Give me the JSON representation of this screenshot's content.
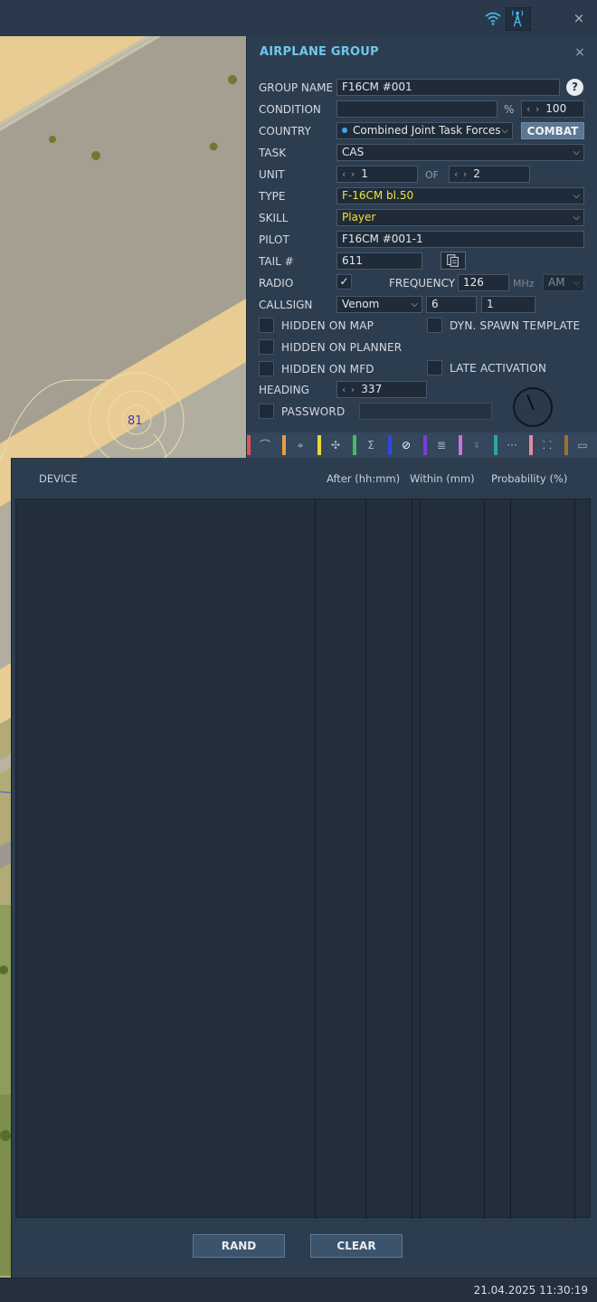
{
  "colors": {
    "accent": "#6fc7ee",
    "combat": "#5d7692",
    "yellow_value": "#f0e23a"
  },
  "topbar": {
    "icons": [
      "wifi-icon",
      "radio-tower-icon",
      "close-icon"
    ],
    "close_glyph": "×"
  },
  "map": {
    "label": "81"
  },
  "panel": {
    "title": "AIRPLANE GROUP",
    "close_glyph": "×",
    "group_name": {
      "label": "GROUP NAME",
      "value": "F16CM #001",
      "help": "?"
    },
    "condition": {
      "label": "CONDITION",
      "value": "",
      "unit": "%",
      "spinner": "100"
    },
    "country": {
      "label": "COUNTRY",
      "value": "Combined Joint Task Forces",
      "button": "COMBAT"
    },
    "task": {
      "label": "TASK",
      "value": "CAS"
    },
    "unit": {
      "label": "UNIT",
      "value": "1",
      "of_label": "OF",
      "of_value": "2"
    },
    "type": {
      "label": "TYPE",
      "value": "F-16CM bl.50"
    },
    "skill": {
      "label": "SKILL",
      "value": "Player"
    },
    "pilot": {
      "label": "PILOT",
      "value": "F16CM #001-1"
    },
    "tail": {
      "label": "TAIL #",
      "value": "611"
    },
    "radio": {
      "label": "RADIO",
      "checked": true,
      "frequency_label": "FREQUENCY",
      "frequency": "126",
      "unit": "MHz",
      "modulation": "AM"
    },
    "callsign": {
      "label": "CALLSIGN",
      "value": "Venom",
      "num1": "6",
      "num2": "1"
    },
    "checkboxes": {
      "hidden_map": "HIDDEN ON MAP",
      "dyn_spawn": "DYN. SPAWN TEMPLATE",
      "hidden_planner": "HIDDEN ON PLANNER",
      "hidden_mfd": "HIDDEN ON MFD",
      "late_activation": "LATE ACTIVATION"
    },
    "heading": {
      "label": "HEADING",
      "value": "337"
    },
    "password": {
      "label": "PASSWORD",
      "value": ""
    }
  },
  "tabs": [
    {
      "icon": "route-icon",
      "color": "#e0505a"
    },
    {
      "icon": "target-icon",
      "color": "#e6a040"
    },
    {
      "icon": "drone-icon",
      "color": "#e6d840"
    },
    {
      "icon": "sum-icon",
      "color": "#3fbf5a"
    },
    {
      "icon": "prohibited-icon",
      "color": "#3048e0",
      "active": true
    },
    {
      "icon": "payload-icon",
      "color": "#7a3fd0"
    },
    {
      "icon": "radio-icon",
      "color": "#cf70d8"
    },
    {
      "icon": "dots-icon",
      "color": "#2aa6a6"
    },
    {
      "icon": "frame-icon",
      "color": "#e08aa0"
    },
    {
      "icon": "camera-icon",
      "color": "#a07030"
    }
  ],
  "table": {
    "headers": {
      "device": "DEVICE",
      "after": "After (hh:mm)",
      "within": "Within (mm)",
      "probability": "Probability (%)"
    }
  },
  "buttons": {
    "rand": "RAND",
    "clear": "CLEAR"
  },
  "status": {
    "datetime": "21.04.2025 11:30:19"
  }
}
